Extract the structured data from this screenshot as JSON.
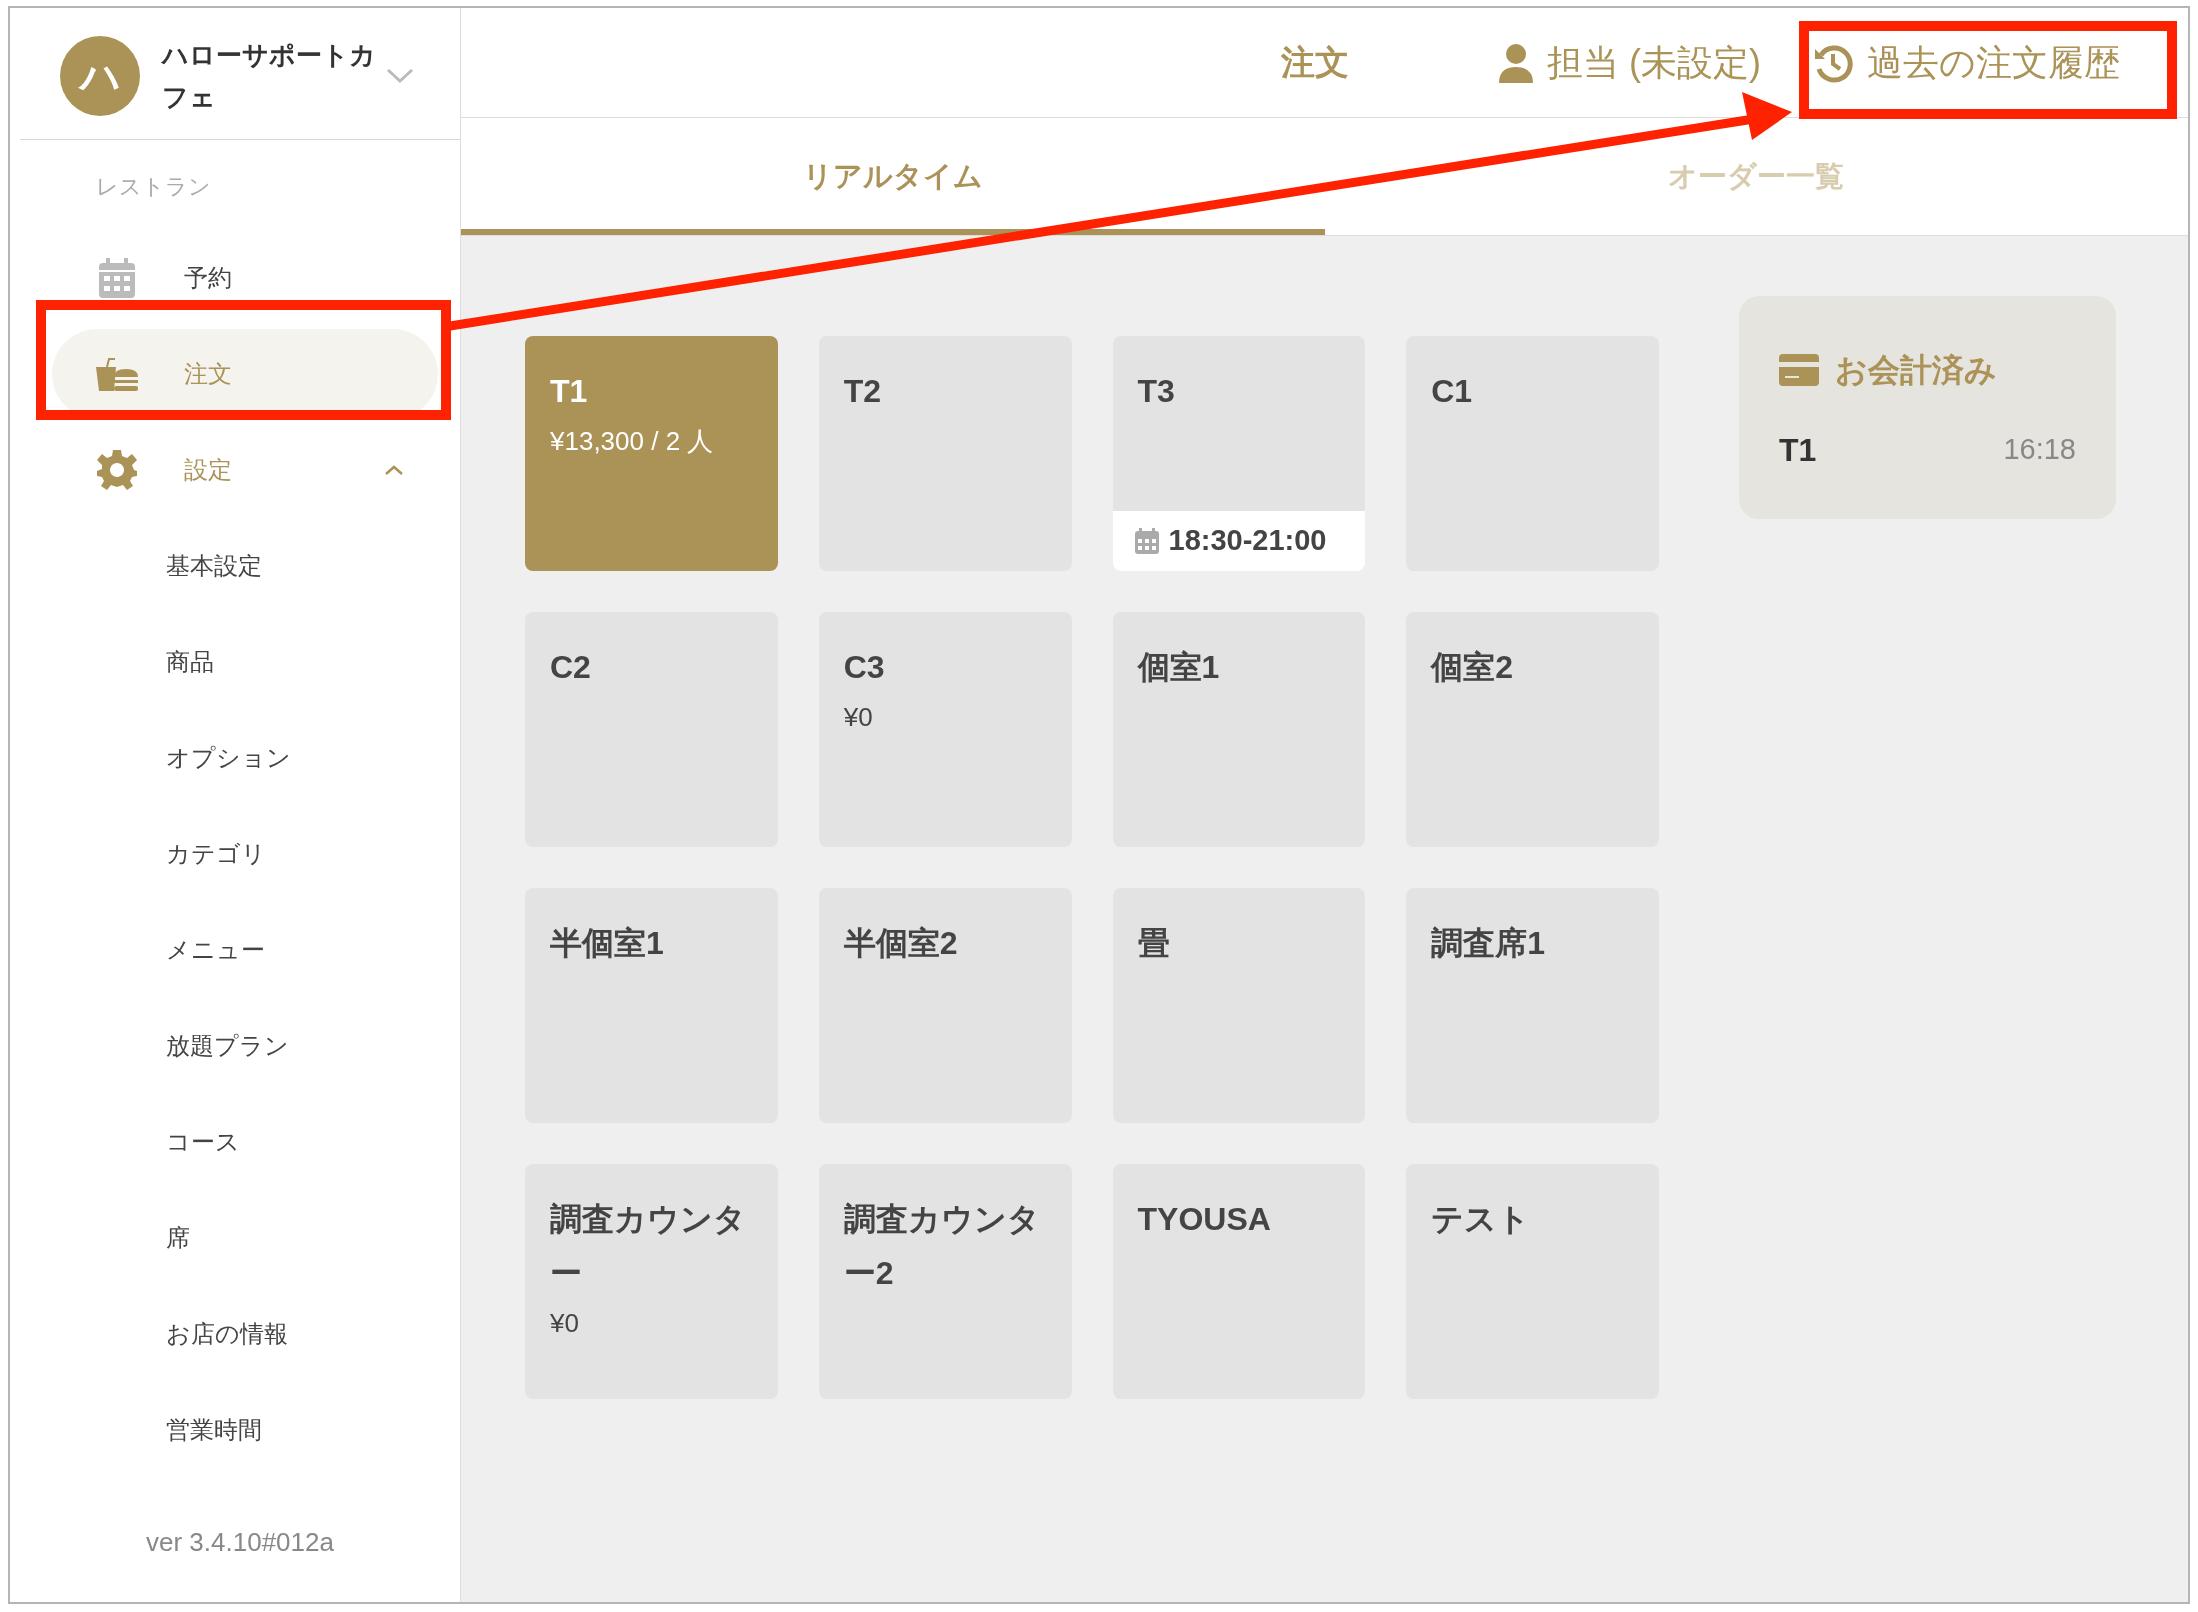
{
  "sidebar": {
    "shop": {
      "avatar": "ハ",
      "name": "ハローサポートカフェ"
    },
    "section_label": "レストラン",
    "items": [
      {
        "label": "予約",
        "selected": false
      },
      {
        "label": "注文",
        "selected": true
      },
      {
        "label": "設定",
        "selected": false,
        "expanded": true,
        "children": [
          {
            "label": "基本設定"
          },
          {
            "label": "商品"
          },
          {
            "label": "オプション"
          },
          {
            "label": "カテゴリ"
          },
          {
            "label": "メニュー"
          },
          {
            "label": "放題プラン"
          },
          {
            "label": "コース"
          },
          {
            "label": "席"
          },
          {
            "label": "お店の情報"
          },
          {
            "label": "営業時間"
          }
        ]
      }
    ],
    "version": "ver 3.4.10#012a"
  },
  "header": {
    "title": "注文",
    "staff": "担当 (未設定)",
    "history": "過去の注文履歴"
  },
  "tabs": [
    {
      "label": "リアルタイム",
      "selected": true
    },
    {
      "label": "オーダー一覧",
      "selected": false
    }
  ],
  "tables": [
    {
      "name": "T1",
      "occupied": true,
      "amount": "¥13,300 / 2 人"
    },
    {
      "name": "T2",
      "occupied": false
    },
    {
      "name": "T3",
      "occupied": false,
      "reservation": "18:30-21:00"
    },
    {
      "name": "C1",
      "occupied": false
    },
    {
      "name": "C2",
      "occupied": false
    },
    {
      "name": "C3",
      "occupied": false,
      "amount": "¥0"
    },
    {
      "name": "個室1",
      "occupied": false
    },
    {
      "name": "個室2",
      "occupied": false
    },
    {
      "name": "半個室1",
      "occupied": false
    },
    {
      "name": "半個室2",
      "occupied": false
    },
    {
      "name": "畳",
      "occupied": false
    },
    {
      "name": "調査席1",
      "occupied": false
    },
    {
      "name": "調査カウンター",
      "occupied": false,
      "amount": "¥0"
    },
    {
      "name": "調査カウンター2",
      "occupied": false
    },
    {
      "name": "TYOUSA",
      "occupied": false
    },
    {
      "name": "テスト",
      "occupied": false
    }
  ],
  "paid_panel": {
    "title": "お会計済み",
    "entries": [
      {
        "table": "T1",
        "time": "16:18"
      }
    ]
  }
}
